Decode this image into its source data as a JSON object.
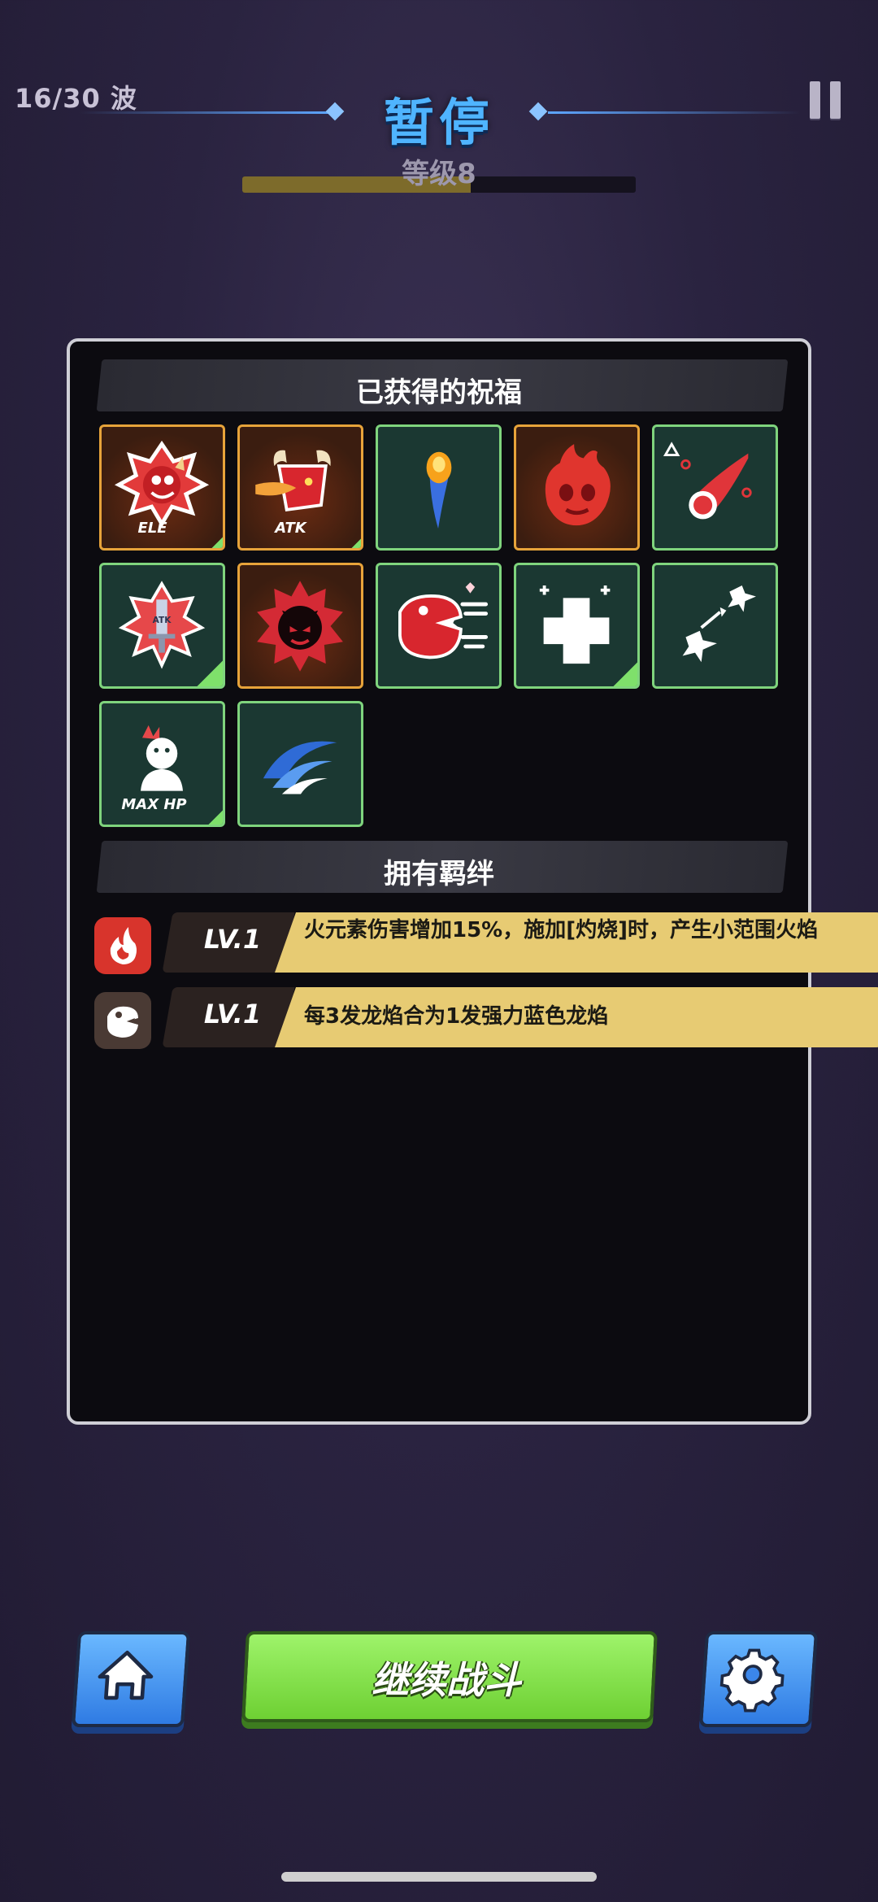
{
  "hud": {
    "wave": "16/30 波",
    "title": "暂停",
    "level_label": "等级8",
    "xp_progress": 0.58
  },
  "blessings": {
    "header": "已获得的祝福",
    "tiles": [
      {
        "icon": "fire-demon-ele-icon",
        "caption": "ELE",
        "frame": "gold"
      },
      {
        "icon": "dragon-atk-icon",
        "caption": "ATK",
        "frame": "gold"
      },
      {
        "icon": "flame-drop-icon",
        "caption": "",
        "frame": "green"
      },
      {
        "icon": "fire-skull-icon",
        "caption": "",
        "frame": "gold"
      },
      {
        "icon": "meteor-icon",
        "caption": "",
        "frame": "green"
      },
      {
        "icon": "sword-atk-burst-icon",
        "caption": "ATK",
        "frame": "green"
      },
      {
        "icon": "devil-burst-icon",
        "caption": "",
        "frame": "gold"
      },
      {
        "icon": "chomping-dragon-icon",
        "caption": "",
        "frame": "green"
      },
      {
        "icon": "heal-plus-icon",
        "caption": "",
        "frame": "green"
      },
      {
        "icon": "dragon-split-icon",
        "caption": "",
        "frame": "green"
      },
      {
        "icon": "max-hp-icon",
        "caption": "MAX HP",
        "frame": "green"
      },
      {
        "icon": "blue-wave-icon",
        "caption": "",
        "frame": "green"
      }
    ]
  },
  "bonds": {
    "header": "拥有羁绊",
    "items": [
      {
        "icon": "fire-bond-icon",
        "level": "LV.1",
        "desc": "火元素伤害增加15%，施加[灼烧]时，产生小范围火焰"
      },
      {
        "icon": "dragon-bond-icon",
        "level": "LV.1",
        "desc": "每3发龙焰合为1发强力蓝色龙焰"
      }
    ]
  },
  "buttons": {
    "continue": "继续战斗"
  },
  "colors": {
    "title": "#4fb4ff",
    "bond_bar": "#e7cb73",
    "continue_button": "#8ee85a",
    "side_button": "#4a9bf2"
  }
}
